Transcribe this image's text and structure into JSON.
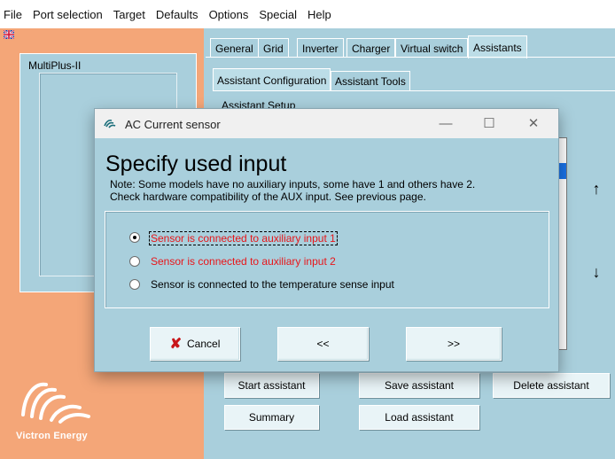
{
  "menubar": {
    "items": [
      "File",
      "Port selection",
      "Target",
      "Defaults",
      "Options",
      "Special",
      "Help"
    ]
  },
  "left_panel": {
    "device_label": "MultiPlus-II",
    "brand": "Victron Energy"
  },
  "main_tabs": [
    "General",
    "Grid",
    "Inverter",
    "Charger",
    "Virtual switch",
    "Assistants"
  ],
  "active_main_tab": "Assistants",
  "sub_tabs": [
    "Assistant Configuration",
    "Assistant Tools"
  ],
  "active_sub_tab": "Assistant Configuration",
  "assistant_setup_label": "Assistant Setup",
  "scroll_buttons": {
    "up_icon": "arrow-up-icon",
    "down_icon": "arrow-down-icon"
  },
  "bottom_buttons": {
    "start": "Start assistant",
    "save": "Save assistant",
    "delete": "Delete assistant",
    "summary": "Summary",
    "load": "Load assistant"
  },
  "dialog": {
    "title": "AC Current sensor",
    "window_controls": {
      "minimize": "—",
      "maximize": "☐",
      "close": "✕"
    },
    "heading": "Specify used input",
    "note_line1": "Note: Some models have no auxiliary inputs, some have 1 and others have 2.",
    "note_line2": "Check hardware compatibility of the AUX input. See previous page.",
    "options": [
      {
        "label": "Sensor is connected to auxiliary input 1",
        "selected": true,
        "color": "#e8161a"
      },
      {
        "label": "Sensor is connected to auxiliary input 2",
        "selected": false,
        "color": "#e8161a"
      },
      {
        "label": "Sensor is connected to the temperature sense input",
        "selected": false,
        "color": "#000000"
      }
    ],
    "buttons": {
      "cancel": "Cancel",
      "back": "<<",
      "next": ">>"
    }
  },
  "colors": {
    "panel_blue": "#a9cfdc",
    "brand_orange": "#f4a678",
    "option_red": "#e8161a"
  }
}
